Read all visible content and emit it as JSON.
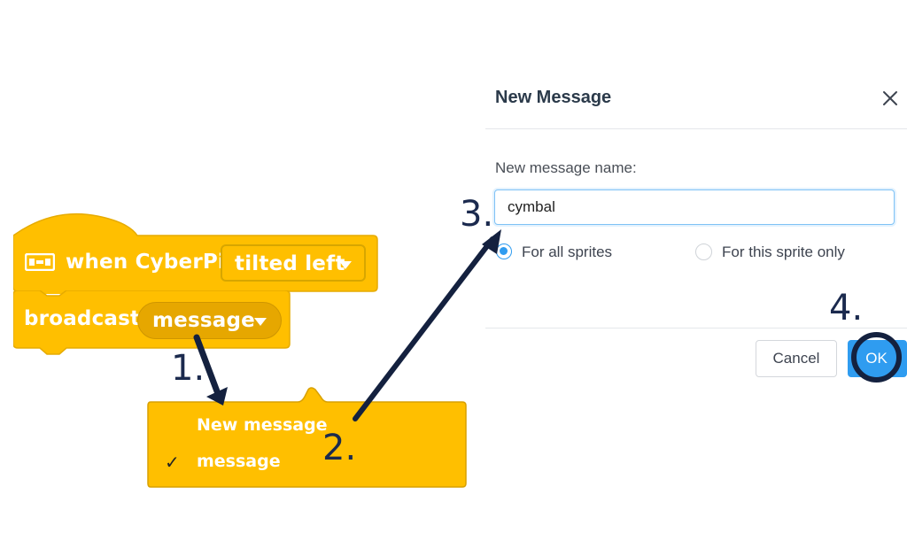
{
  "blocks": {
    "hat": {
      "label": "when CyberPi",
      "field_value": "tilted left"
    },
    "command": {
      "label": "broadcast",
      "field_value": "message"
    },
    "dropdown": {
      "items": [
        {
          "label": "New message",
          "checked": false
        },
        {
          "label": "message",
          "checked": true
        }
      ],
      "check_mark": "✓"
    }
  },
  "steps": [
    "1.",
    "2.",
    "3.",
    "4."
  ],
  "dialog": {
    "title": "New Message",
    "field_label": "New message name:",
    "name_value": "cymbal",
    "radio_options": [
      {
        "label": "For all sprites",
        "selected": true
      },
      {
        "label": "For this sprite only",
        "selected": false
      }
    ],
    "cancel_label": "Cancel",
    "ok_label": "OK"
  },
  "colors": {
    "block_yellow": "#FFBF00",
    "block_dark_yellow": "#E6A700",
    "accent_blue": "#2F9CF0",
    "annotation_navy": "#14213F"
  },
  "icons": [
    "event-sensor-icon",
    "dropdown-arrow-icon",
    "checkmark-icon",
    "close-icon"
  ]
}
